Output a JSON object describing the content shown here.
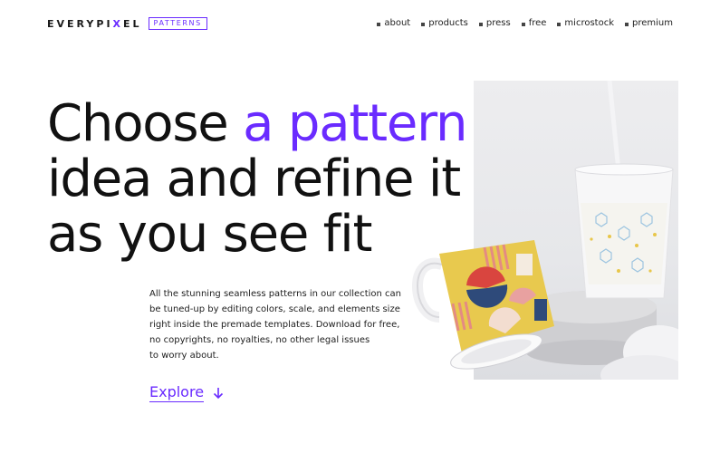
{
  "logo": {
    "word_left": "EVERYPI",
    "word_x": "X",
    "word_right": "EL",
    "badge": "PATTERNS"
  },
  "nav": [
    {
      "label": "about"
    },
    {
      "label": "products"
    },
    {
      "label": "press"
    },
    {
      "label": "free"
    },
    {
      "label": "microstock"
    },
    {
      "label": "premium"
    }
  ],
  "hero": {
    "line1_prefix": "Choose ",
    "line1_accent": "a pattern",
    "line2": "idea and refine it",
    "line3": "as you see fit"
  },
  "description": {
    "line1": "All the stunning seamless patterns in our collection can",
    "line2": "be tuned-up by editing colors, scale, and elements size",
    "line3": "right inside the premade templates. Download for free,",
    "line4": "no copyrights, no royalties, no other legal issues",
    "line5": "to worry about."
  },
  "cta": {
    "label": "Explore",
    "icon": "arrow-down-icon"
  },
  "colors": {
    "accent": "#6a2bff",
    "text": "#111111",
    "background": "#ffffff"
  }
}
